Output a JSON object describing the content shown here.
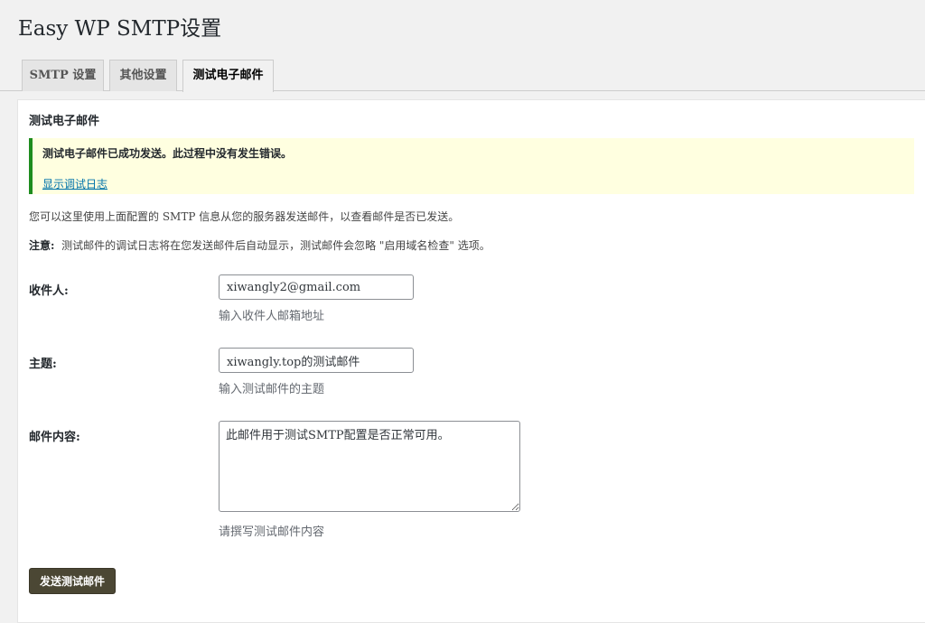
{
  "page": {
    "title": "Easy WP SMTP设置"
  },
  "tabs": [
    {
      "label": "SMTP 设置",
      "active": false
    },
    {
      "label": "其他设置",
      "active": false
    },
    {
      "label": "测试电子邮件",
      "active": true
    }
  ],
  "panel": {
    "heading": "测试电子邮件",
    "notice": {
      "message": "测试电子邮件已成功发送。此过程中没有发生错误。",
      "log_link": "显示调试日志",
      "border_color": "#1e8c1e",
      "background": "#ffffe0"
    },
    "description": "您可以这里使用上面配置的 SMTP 信息从您的服务器发送邮件，以查看邮件是否已发送。",
    "note_label": "注意:",
    "note_text": "测试邮件的调试日志将在您发送邮件后自动显示，测试邮件会忽略 \"启用域名检查\" 选项。"
  },
  "form": {
    "recipient": {
      "label": "收件人:",
      "value": "xiwangly2@gmail.com",
      "hint": "输入收件人邮箱地址"
    },
    "subject": {
      "label": "主题:",
      "value": "xiwangly.top的测试邮件",
      "hint": "输入测试邮件的主题"
    },
    "body": {
      "label": "邮件内容:",
      "value": "此邮件用于测试SMTP配置是否正常可用。",
      "hint": "请撰写测试邮件内容"
    },
    "submit_label": "发送测试邮件"
  },
  "colors": {
    "button_bg": "#4b4734",
    "link": "#0073aa"
  }
}
